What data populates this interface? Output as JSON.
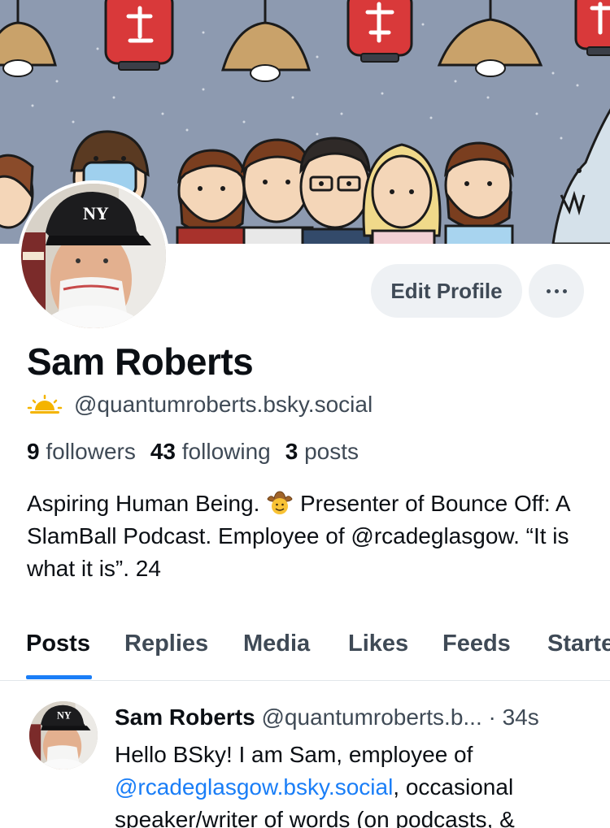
{
  "profile": {
    "display_name": "Sam Roberts",
    "handle": "@quantumroberts.bsky.social",
    "handle_icon": "sun-icon",
    "stats": {
      "followers_count": "9",
      "followers_label": "followers",
      "following_count": "43",
      "following_label": "following",
      "posts_count": "3",
      "posts_label": "posts"
    },
    "bio": {
      "part1": "Aspiring Human Being.",
      "part2": "Presenter of Bounce Off: A SlamBall Podcast. Employee of @rcadeglasgow. “It is what it is”. 24"
    }
  },
  "actions": {
    "edit_profile_label": "Edit Profile",
    "more_icon": "ellipsis-icon"
  },
  "tabs": [
    {
      "label": "Posts",
      "active": true
    },
    {
      "label": "Replies",
      "active": false
    },
    {
      "label": "Media",
      "active": false
    },
    {
      "label": "Likes",
      "active": false
    },
    {
      "label": "Feeds",
      "active": false
    },
    {
      "label": "Starte",
      "active": false
    }
  ],
  "post": {
    "author": "Sam Roberts",
    "handle_time": "@quantumroberts.b... · 34s",
    "text_before": "Hello BSky! I am Sam, employee of",
    "mention": "@rcadeglasgow.bsky.social",
    "text_after": ", occasional speaker/writer of words (on podcasts, &"
  },
  "colors": {
    "accent": "#1a7ef7",
    "text_primary": "#0b0f14",
    "text_secondary": "#3f4a56",
    "button_bg": "#eef1f4",
    "banner_bg": "#8d9ab0"
  }
}
